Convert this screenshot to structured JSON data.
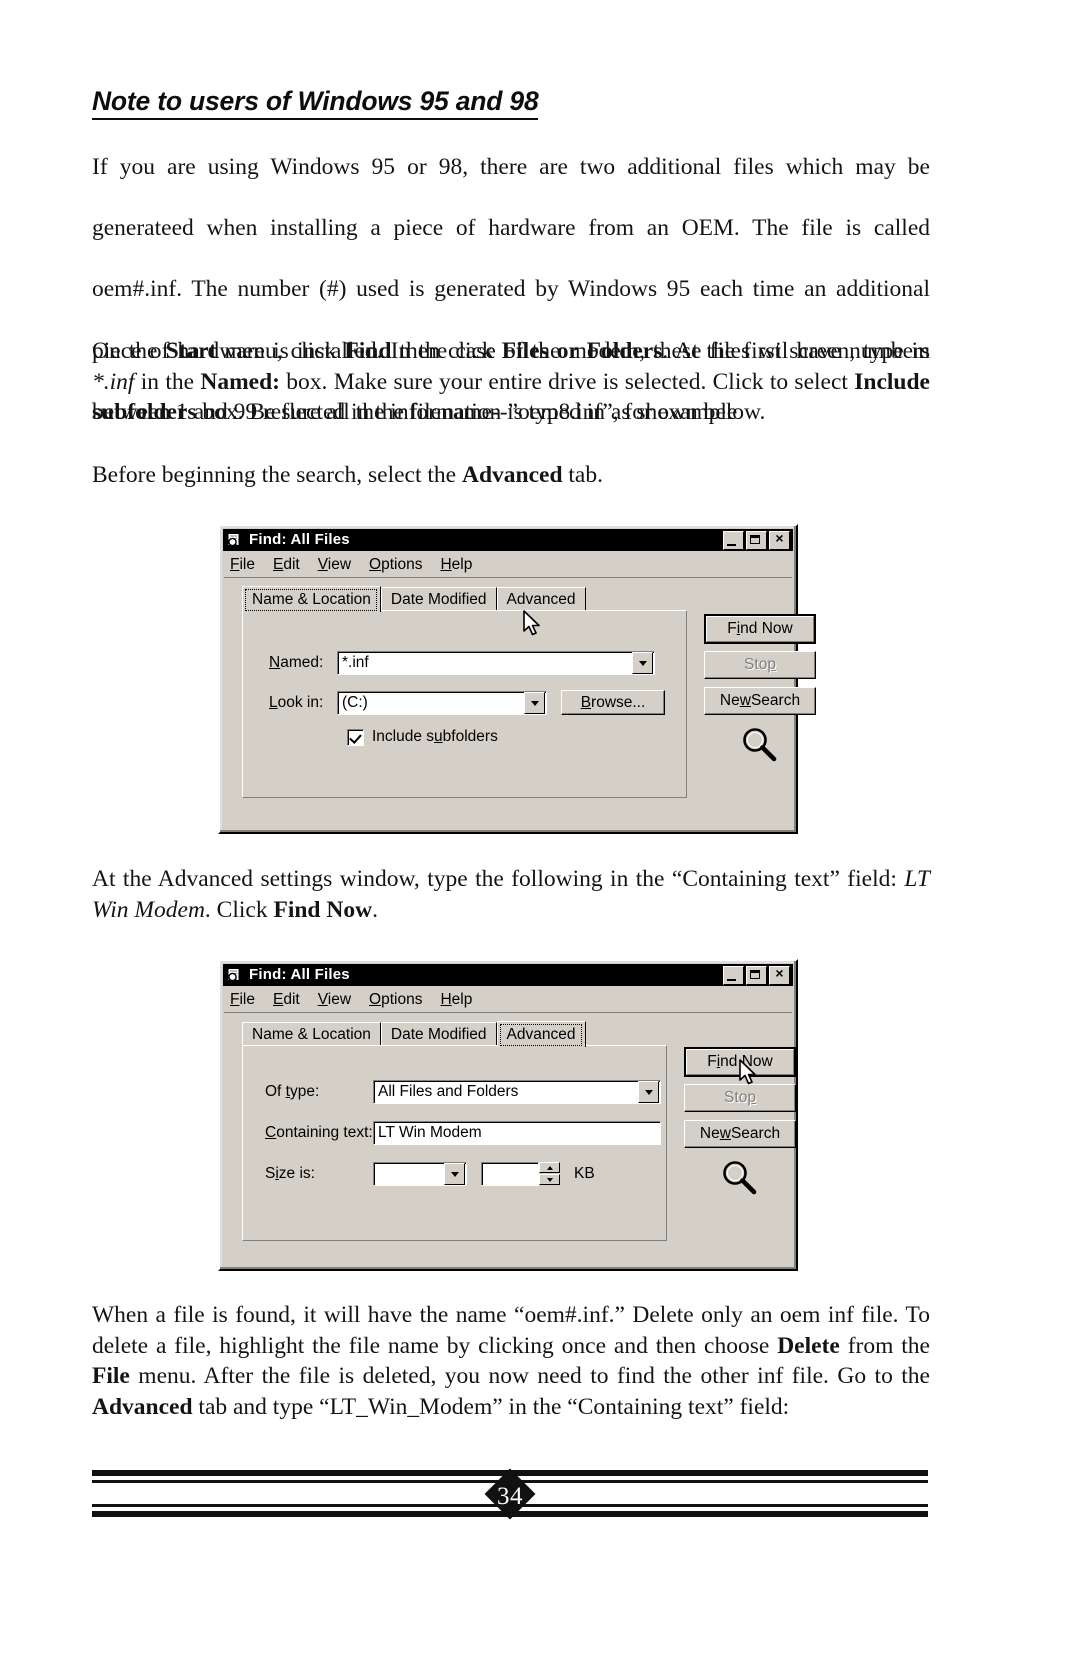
{
  "document": {
    "heading": "Note to users of Windows 95 and 98",
    "paragraph1": {
      "line1": "If you are using Windows 95 or 98, there are two additional files which may be",
      "line2": "generateed when installing a piece of hardware from an OEM. The file is called",
      "line3": "oem#.inf. The number (#)  used is generated by Windows 95 each time an additional",
      "line4": "piece of hardware is installed. In the case of the modem, these files wil have numbers",
      "line5": "between 1 and 99 reflected in the filename--”oem8.inf”, for example"
    },
    "paragraph2": {
      "seg1": "On the ",
      "b1": "Start",
      "seg2": " menu, click ",
      "b2": "Find",
      "seg3": " then click ",
      "b3": "Files or Folders",
      "seg4": ". At the first screen, type in ",
      "i1": "*.inf",
      "seg5": " in the ",
      "b4": "Named:",
      "seg6": " box. Make sure your entire drive is selected. Click to select ",
      "b5": "Include subfolders",
      "seg7": " box. Be sure all the information is typed in as shown below."
    },
    "paragraph3": {
      "seg1": "Before beginning the search, select the ",
      "b1": "Advanced",
      "seg2": " tab."
    },
    "paragraph4": {
      "seg1": "At the Advanced settings window, type the following in the “Containing text” field: ",
      "i1": "LT Win Modem",
      "seg2": ". Click ",
      "b1": "Find Now",
      "seg3": "."
    },
    "paragraph5": {
      "seg1": "When a file is found, it will have the name “oem#.inf.” Delete only an oem inf file. To delete a file, highlight the file name by clicking once and then choose ",
      "b1": "Delete",
      "seg2": " from the ",
      "b2": "File",
      "seg3": " menu. After the file is deleted, you now need to find the other inf file. Go to the ",
      "b3": "Advanced",
      "seg4": " tab and type “LT_Win_Modem” in the “Containing text” field:"
    },
    "footer": {
      "page_number": "34"
    }
  },
  "dialog1": {
    "title": "Find: All Files",
    "title_icon": "find-files-icon",
    "window_buttons": {
      "minimize": "minimize-button",
      "maximize": "maximize-button",
      "close": "×"
    },
    "menu": [
      {
        "pre": "",
        "accel": "F",
        "post": "ile"
      },
      {
        "pre": "",
        "accel": "E",
        "post": "dit"
      },
      {
        "pre": "",
        "accel": "V",
        "post": "iew"
      },
      {
        "pre": "",
        "accel": "O",
        "post": "ptions"
      },
      {
        "pre": "",
        "accel": "H",
        "post": "elp"
      }
    ],
    "tabs": [
      {
        "label": "Name & Location",
        "selected": true
      },
      {
        "label": "Date Modified",
        "selected": false
      },
      {
        "label": "Advanced",
        "selected": false
      }
    ],
    "fields": {
      "named_label_pre": "",
      "named_label_accel": "N",
      "named_label_post": "amed:",
      "named_value": "*.inf",
      "lookin_label_pre": "",
      "lookin_label_accel": "L",
      "lookin_label_post": "ook in:",
      "lookin_value": "(C:)",
      "browse_pre": "",
      "browse_accel": "B",
      "browse_post": "rowse...",
      "include_subfolders_label_pre": "Include s",
      "include_subfolders_label_accel": "u",
      "include_subfolders_label_post": "bfolders",
      "include_subfolders_checked": true
    },
    "buttons": {
      "find_now_pre": "F",
      "find_now_accel": "i",
      "find_now_post": "nd Now",
      "stop_pre": "Sto",
      "stop_accel": "p",
      "stop_post": "",
      "stop_disabled": true,
      "new_search_pre": "Ne",
      "new_search_accel": "w",
      "new_search_post": " Search"
    },
    "magnifier_icon": "magnifier-icon",
    "cursor_icon": "mouse-pointer-icon"
  },
  "dialog2": {
    "title": "Find: All Files",
    "title_icon": "find-files-icon",
    "window_buttons": {
      "minimize": "minimize-button",
      "maximize": "maximize-button",
      "close": "×"
    },
    "menu": [
      {
        "pre": "",
        "accel": "F",
        "post": "ile"
      },
      {
        "pre": "",
        "accel": "E",
        "post": "dit"
      },
      {
        "pre": "",
        "accel": "V",
        "post": "iew"
      },
      {
        "pre": "",
        "accel": "O",
        "post": "ptions"
      },
      {
        "pre": "",
        "accel": "H",
        "post": "elp"
      }
    ],
    "tabs": [
      {
        "label": "Name & Location",
        "selected": false
      },
      {
        "label": "Date Modified",
        "selected": false
      },
      {
        "label": "Advanced",
        "selected": true
      }
    ],
    "fields": {
      "oftype_label_pre": "Of ",
      "oftype_label_accel": "t",
      "oftype_label_post": "ype:",
      "oftype_value": "All Files and Folders",
      "containing_label_pre": "",
      "containing_label_accel": "C",
      "containing_label_post": "ontaining text:",
      "containing_value": "LT Win Modem",
      "sizeis_label_pre": "S",
      "sizeis_label_accel": "i",
      "sizeis_label_post": "ze is:",
      "size_compare_value": "",
      "size_number_value": "",
      "size_unit": "KB"
    },
    "buttons": {
      "find_now_pre": "F",
      "find_now_accel": "i",
      "find_now_post": "nd Now",
      "stop_pre": "Sto",
      "stop_accel": "p",
      "stop_post": "",
      "stop_disabled": true,
      "new_search_pre": "Ne",
      "new_search_accel": "w",
      "new_search_post": " Search"
    },
    "magnifier_icon": "magnifier-icon",
    "cursor_icon": "mouse-pointer-icon"
  },
  "colors": {
    "window_face": "#d4d0c8",
    "titlebar": "#000000",
    "titlebar_text": "#ffffff",
    "text": "#000000",
    "disabled_text": "#808080",
    "page_background": "#ffffff"
  }
}
